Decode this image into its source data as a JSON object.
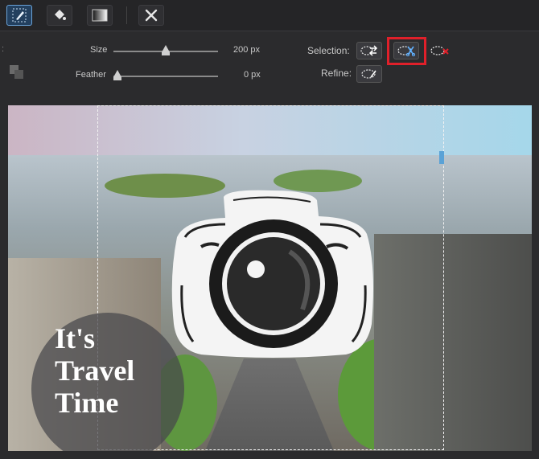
{
  "toolbar": {
    "tools": [
      {
        "icon": "brush-select-icon",
        "active": true
      },
      {
        "icon": "paint-bucket-icon",
        "active": false
      },
      {
        "icon": "gradient-icon",
        "active": false
      },
      {
        "icon": "tools-icon",
        "active": false
      }
    ]
  },
  "options": {
    "size_label": "Size",
    "size_value": "200 px",
    "size_fraction": 0.5,
    "feather_label": "Feather",
    "feather_value": "0 px",
    "feather_fraction": 0.0,
    "selection_label": "Selection:",
    "refine_label": "Refine:",
    "selection_buttons": [
      {
        "icon": "selection-invert-icon"
      },
      {
        "icon": "selection-cut-icon",
        "highlighted": true
      },
      {
        "icon": "selection-clear-icon"
      }
    ],
    "refine_button_icon": "refine-lasso-icon",
    "highlight_color": "#e0202a"
  },
  "canvas": {
    "text_overlay": "It's\nTravel\nTime"
  }
}
